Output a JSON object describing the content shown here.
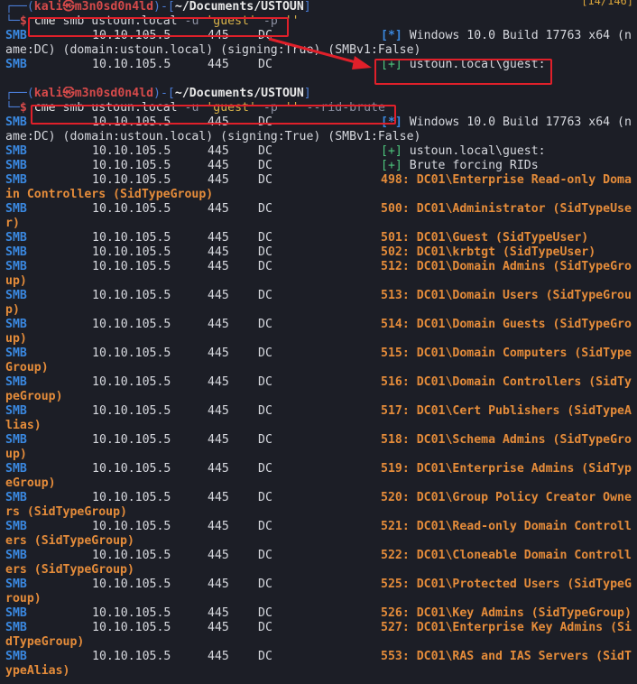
{
  "counter": "[14/146]",
  "session1": {
    "prompt_user": "kali",
    "prompt_at": "㉿",
    "prompt_host": "m3n0sd0n4ld",
    "prompt_path": "~/Documents/USTOUN",
    "cmd_tool": "cme",
    "cmd_args": " smb ustoun.local ",
    "cmd_u": "-u",
    "cmd_user": " 'guest' ",
    "cmd_p": "-p",
    "cmd_pass": " ''",
    "out": [
      {
        "prefix": "SMB",
        "ip": "10.10.105.5",
        "port": "445",
        "host": "DC",
        "tag": "[*]",
        "msg": " Windows 10.0 Build 17763 x64 (n"
      },
      {
        "cont": "ame:DC) (domain:ustoun.local) (signing:True) (SMBv1:False)"
      },
      {
        "prefix": "SMB",
        "ip": "10.10.105.5",
        "port": "445",
        "host": "DC",
        "tag": "[+]",
        "msg": " ustoun.local\\guest:"
      }
    ]
  },
  "session2": {
    "prompt_user": "kali",
    "prompt_at": "㉿",
    "prompt_host": "m3n0sd0n4ld",
    "prompt_path": "~/Documents/USTOUN",
    "cmd_tool": "cme",
    "cmd_args": " smb ustoun.local ",
    "cmd_u": "-u",
    "cmd_user": " 'guest' ",
    "cmd_p": "-p",
    "cmd_pass": " '' ",
    "cmd_flag": "--rid-brute",
    "header": [
      {
        "prefix": "SMB",
        "ip": "10.10.105.5",
        "port": "445",
        "host": "DC",
        "tag": "[*]",
        "msg": " Windows 10.0 Build 17763 x64 (n"
      },
      {
        "cont": "ame:DC) (domain:ustoun.local) (signing:True) (SMBv1:False)"
      },
      {
        "prefix": "SMB",
        "ip": "10.10.105.5",
        "port": "445",
        "host": "DC",
        "tag": "[+]",
        "msg": " ustoun.local\\guest:"
      },
      {
        "prefix": "SMB",
        "ip": "10.10.105.5",
        "port": "445",
        "host": "DC",
        "tag": "[+]",
        "msg": " Brute forcing RIDs"
      }
    ],
    "rids": [
      {
        "text": "498: DC01\\Enterprise Read-only Doma",
        "wrap": "in Controllers (SidTypeGroup)"
      },
      {
        "text": "500: DC01\\Administrator (SidTypeUse",
        "wrap": "r)"
      },
      {
        "text": "501: DC01\\Guest (SidTypeUser)"
      },
      {
        "text": "502: DC01\\krbtgt (SidTypeUser)"
      },
      {
        "text": "512: DC01\\Domain Admins (SidTypeGro",
        "wrap": "up)"
      },
      {
        "text": "513: DC01\\Domain Users (SidTypeGrou",
        "wrap": "p)"
      },
      {
        "text": "514: DC01\\Domain Guests (SidTypeGro",
        "wrap": "up)"
      },
      {
        "text": "515: DC01\\Domain Computers (SidType",
        "wrap": "Group)"
      },
      {
        "text": "516: DC01\\Domain Controllers (SidTy",
        "wrap": "peGroup)"
      },
      {
        "text": "517: DC01\\Cert Publishers (SidTypeA",
        "wrap": "lias)"
      },
      {
        "text": "518: DC01\\Schema Admins (SidTypeGro",
        "wrap": "up)"
      },
      {
        "text": "519: DC01\\Enterprise Admins (SidTyp",
        "wrap": "eGroup)"
      },
      {
        "text": "520: DC01\\Group Policy Creator Owne",
        "wrap": "rs (SidTypeGroup)"
      },
      {
        "text": "521: DC01\\Read-only Domain Controll",
        "wrap": "ers (SidTypeGroup)"
      },
      {
        "text": "522: DC01\\Cloneable Domain Controll",
        "wrap": "ers (SidTypeGroup)"
      },
      {
        "text": "525: DC01\\Protected Users (SidTypeG",
        "wrap": "roup)"
      },
      {
        "text": "526: DC01\\Key Admins (SidTypeGroup)"
      },
      {
        "text": "527: DC01\\Enterprise Key Admins (Si",
        "wrap": "dTypeGroup)"
      },
      {
        "text": "553: DC01\\RAS and IAS Servers (SidT",
        "wrap": "ypeAlias)"
      }
    ],
    "rid_prefix": "SMB",
    "rid_ip": "10.10.105.5",
    "rid_port": "445",
    "rid_host": "DC"
  },
  "colors": {
    "background": "#1c1e26",
    "highlight_box": "#e0202a",
    "rid_output": "#e58c3a",
    "smb_label": "#3a88e0",
    "success_tag": "#4ec77d"
  }
}
